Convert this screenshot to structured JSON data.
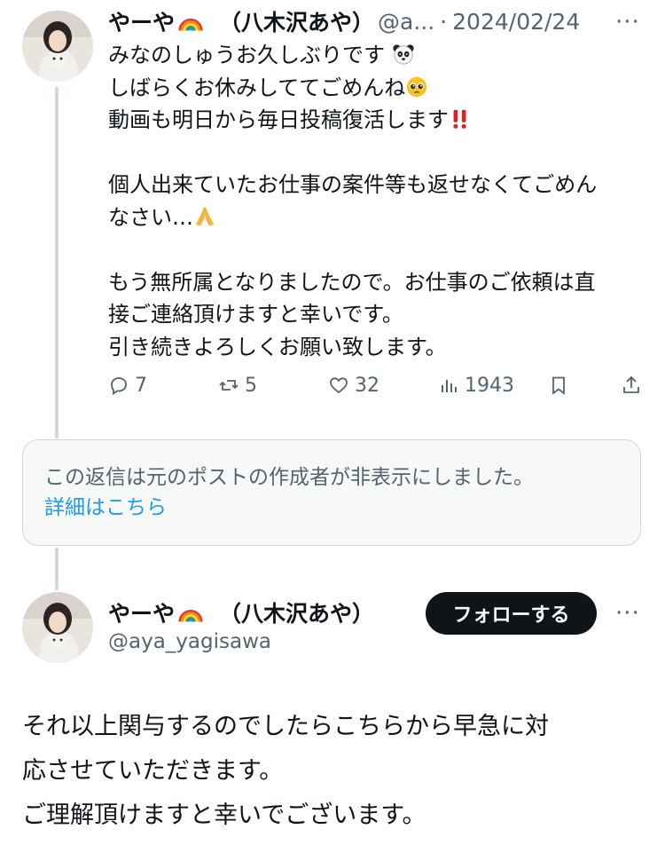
{
  "tweet1": {
    "display_name": "やーや",
    "full_name": "（八木沢あや）",
    "handle_truncated": "@a...",
    "separator": "·",
    "date": "2024/02/24",
    "more_label": "···",
    "lines": [
      "みなのしゅうお久しぶりです",
      "しばらくお休みしててごめんね",
      "動画も明日から毎日投稿復活します",
      "",
      "個人出来ていたお仕事の案件等も返せなくてごめん",
      "なさい…",
      "",
      "もう無所属となりましたので。お仕事のご依頼は直",
      "接ご連絡頂けますと幸いです。",
      "引き続きよろしくお願い致します。"
    ],
    "actions": {
      "replies": "7",
      "reposts": "5",
      "likes": "32",
      "views": "1943"
    }
  },
  "hidden_reply": {
    "message": "この返信は元のポストの作成者が非表示にしました。",
    "link": "詳細はこちら"
  },
  "tweet2": {
    "display_name": "やーや",
    "full_name": "（八木沢あや）",
    "handle": "@aya_yagisawa",
    "follow_label": "フォローする",
    "more_label": "···",
    "lines": [
      "それ以上関与するのでしたらこちらから早急に対",
      "応させていただきます。",
      "ご理解頂けますと幸いでございます。"
    ]
  },
  "icons": {
    "rainbow": "rainbow-emoji",
    "panda": "panda-emoji",
    "pleading": "pleading-face-emoji",
    "double_exclamation": "double-exclamation-emoji",
    "folded_hands": "folded-hands-emoji",
    "reply": "reply-icon",
    "repost": "repost-icon",
    "like": "heart-icon",
    "views": "views-icon",
    "bookmark": "bookmark-icon",
    "share": "share-icon"
  },
  "colors": {
    "text_primary": "#0f1419",
    "text_secondary": "#536471",
    "link": "#1d9bf0",
    "thread_line": "#cfd9de",
    "box_bg": "#f7f9f9",
    "button_bg": "#0f1419"
  }
}
